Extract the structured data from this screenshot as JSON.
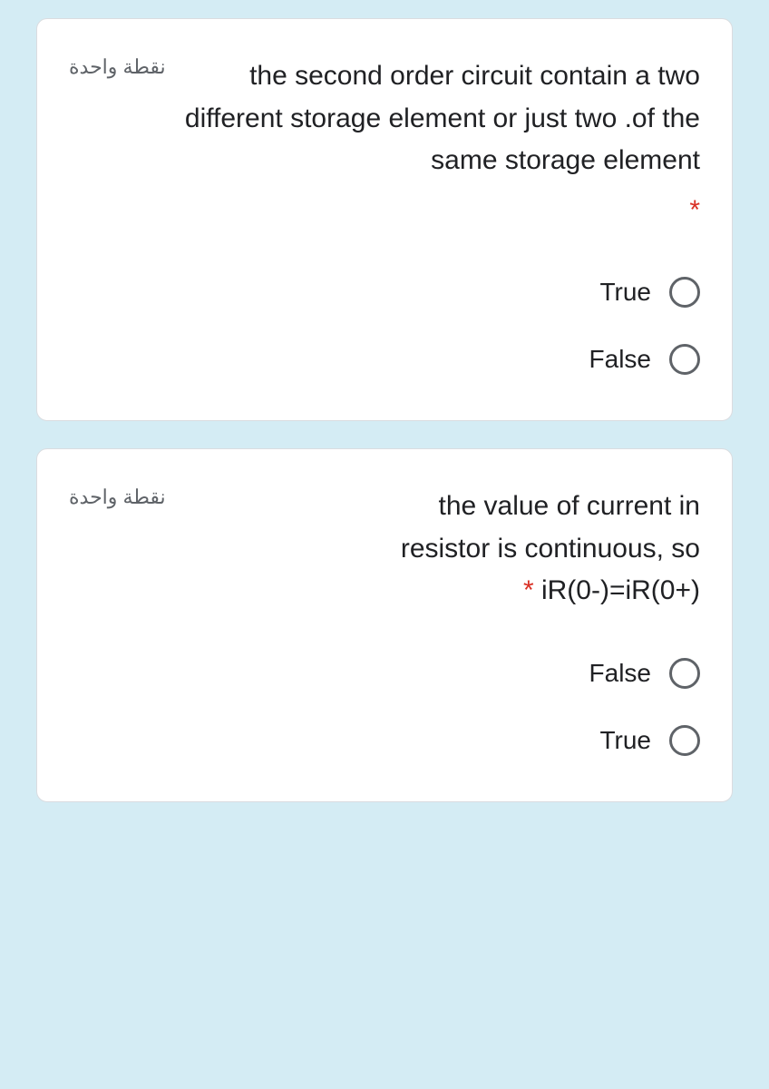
{
  "questions": [
    {
      "points": "نقطة واحدة",
      "text": "the second order circuit contain a two different storage element or just two .of the same storage element",
      "required": "*",
      "options": [
        {
          "label": "True"
        },
        {
          "label": "False"
        }
      ]
    },
    {
      "points": "نقطة واحدة",
      "text_line1": "the value of current in",
      "text_line2": "resistor is continuous, so",
      "text_line3_prefix": "* ",
      "text_line3": "iR(0-)=iR(0+)",
      "options": [
        {
          "label": "False"
        },
        {
          "label": "True"
        }
      ]
    }
  ]
}
